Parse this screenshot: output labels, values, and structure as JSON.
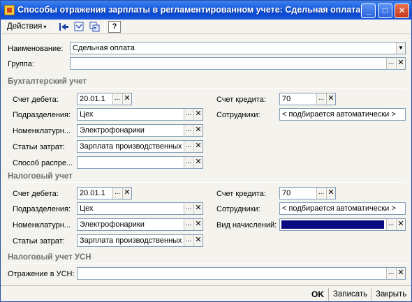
{
  "window": {
    "title": "Способы отражения зарплаты в регламентированном учете: Сдельная оплата",
    "minimize_label": "_",
    "maximize_label": "□",
    "close_label": "✕"
  },
  "toolbar": {
    "actions_label": "Действия",
    "actions_arrow": "▾",
    "help_label": "?"
  },
  "form": {
    "name_label": "Наименование:",
    "name_value": "Сдельная оплата",
    "group_label": "Группа:",
    "group_value": ""
  },
  "accounting": {
    "section_title": "Бухгалтерский учет",
    "debit_label": "Счет дебета:",
    "debit_value": "20.01.1",
    "credit_label": "Счет кредита:",
    "credit_value": "70",
    "subdivisions_label": "Подразделения:",
    "subdivisions_value": "Цех",
    "employees_label": "Сотрудники:",
    "employees_value": "< подбирается автоматически >",
    "nomenclature_label": "Номенклатурн...",
    "nomenclature_value": "Электрофонарики",
    "cost_items_label": "Статьи затрат:",
    "cost_items_value": "Зарплата производственных",
    "distribution_label": "Способ распре...",
    "distribution_value": ""
  },
  "tax": {
    "section_title": "Налоговый учет",
    "debit_label": "Счет дебета:",
    "debit_value": "20.01.1",
    "credit_label": "Счет кредита:",
    "credit_value": "70",
    "subdivisions_label": "Подразделения:",
    "subdivisions_value": "Цех",
    "employees_label": "Сотрудники:",
    "employees_value": "< подбирается автоматически >",
    "nomenclature_label": "Номенклатурн...",
    "nomenclature_value": "Электрофонарики",
    "accrual_type_label": "Вид начислений:",
    "accrual_type_value": "",
    "cost_items_label": "Статьи затрат:",
    "cost_items_value": "Зарплата производственных"
  },
  "usn": {
    "section_title": "Налоговый учет УСН",
    "reflection_label": "Отражение в УСН:",
    "reflection_value": ""
  },
  "buttons": {
    "ok": "OK",
    "save": "Записать",
    "close": "Закрыть",
    "dots": "...",
    "clear": "✕",
    "dropdown": "▼"
  },
  "colors": {
    "titlebar": "#0a49d4",
    "selection": "#0a0a80",
    "section_text": "#707070"
  }
}
